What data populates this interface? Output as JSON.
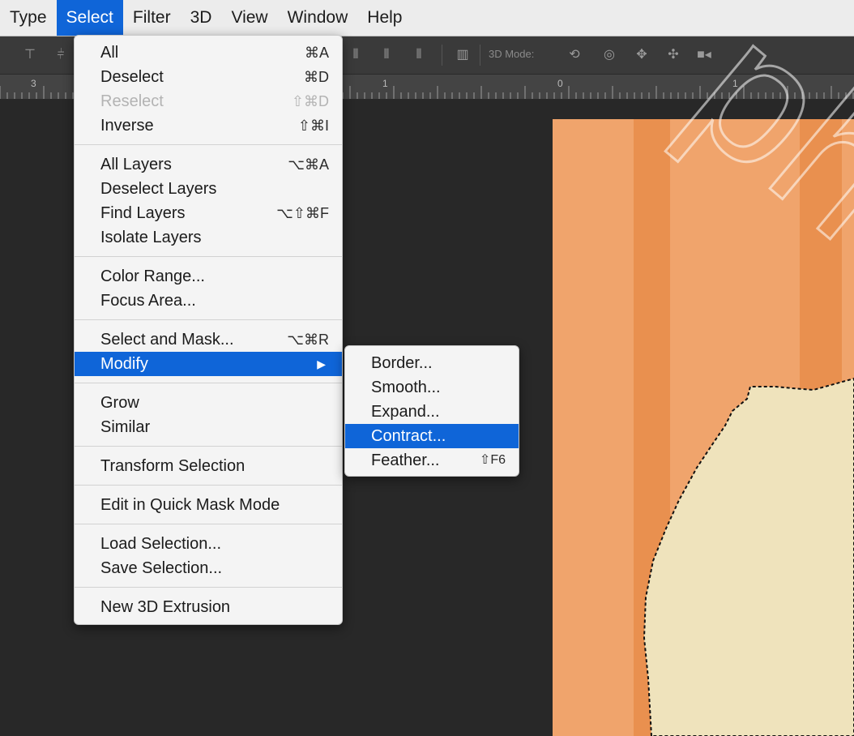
{
  "menubar": {
    "items": [
      "Type",
      "Select",
      "Filter",
      "3D",
      "View",
      "Window",
      "Help"
    ],
    "active": "Select"
  },
  "optionsbar": {
    "mode_label": "3D Mode:"
  },
  "ruler": {
    "labels": [
      "3",
      "1",
      "0",
      "1"
    ]
  },
  "select_menu": {
    "groups": [
      [
        {
          "label": "All",
          "shortcut": "⌘A",
          "enabled": true
        },
        {
          "label": "Deselect",
          "shortcut": "⌘D",
          "enabled": true
        },
        {
          "label": "Reselect",
          "shortcut": "⇧⌘D",
          "enabled": false
        },
        {
          "label": "Inverse",
          "shortcut": "⇧⌘I",
          "enabled": true
        }
      ],
      [
        {
          "label": "All Layers",
          "shortcut": "⌥⌘A",
          "enabled": true
        },
        {
          "label": "Deselect Layers",
          "shortcut": "",
          "enabled": true
        },
        {
          "label": "Find Layers",
          "shortcut": "⌥⇧⌘F",
          "enabled": true
        },
        {
          "label": "Isolate Layers",
          "shortcut": "",
          "enabled": true
        }
      ],
      [
        {
          "label": "Color Range...",
          "shortcut": "",
          "enabled": true
        },
        {
          "label": "Focus Area...",
          "shortcut": "",
          "enabled": true
        }
      ],
      [
        {
          "label": "Select and Mask...",
          "shortcut": "⌥⌘R",
          "enabled": true
        },
        {
          "label": "Modify",
          "shortcut": "",
          "enabled": true,
          "submenu": true,
          "highlighted": true
        }
      ],
      [
        {
          "label": "Grow",
          "shortcut": "",
          "enabled": true
        },
        {
          "label": "Similar",
          "shortcut": "",
          "enabled": true
        }
      ],
      [
        {
          "label": "Transform Selection",
          "shortcut": "",
          "enabled": true
        }
      ],
      [
        {
          "label": "Edit in Quick Mask Mode",
          "shortcut": "",
          "enabled": true
        }
      ],
      [
        {
          "label": "Load Selection...",
          "shortcut": "",
          "enabled": true
        },
        {
          "label": "Save Selection...",
          "shortcut": "",
          "enabled": true
        }
      ],
      [
        {
          "label": "New 3D Extrusion",
          "shortcut": "",
          "enabled": true
        }
      ]
    ]
  },
  "modify_submenu": {
    "items": [
      {
        "label": "Border...",
        "shortcut": ""
      },
      {
        "label": "Smooth...",
        "shortcut": ""
      },
      {
        "label": "Expand...",
        "shortcut": ""
      },
      {
        "label": "Contract...",
        "shortcut": "",
        "highlighted": true
      },
      {
        "label": "Feather...",
        "shortcut": "⇧F6"
      }
    ]
  },
  "canvas": {
    "background_color": "#f0a46c",
    "stripe_color": "#e9904f",
    "shape_color": "#efe3bc"
  },
  "watermark": {
    "text": "photo"
  },
  "colors": {
    "accent": "#0f65d8",
    "menu_bg": "#f4f4f4",
    "app_bg": "#282828"
  }
}
